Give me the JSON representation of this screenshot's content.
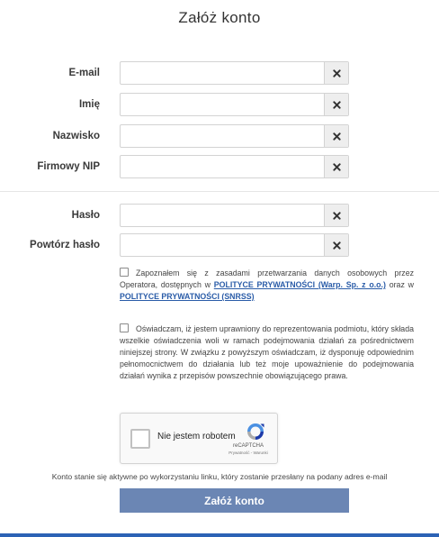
{
  "page_title": "Załóż konto",
  "fields": [
    {
      "label": "E-mail",
      "value": ""
    },
    {
      "label": "Imię",
      "value": ""
    },
    {
      "label": "Nazwisko",
      "value": ""
    },
    {
      "label": "Firmowy NIP",
      "value": ""
    },
    {
      "label": "Hasło",
      "value": ""
    },
    {
      "label": "Powtórz hasło",
      "value": ""
    }
  ],
  "clear_icon": "close-icon",
  "consent1": {
    "checked": false,
    "text_part1": "Zapoznałem się z zasadami przetwarzania danych osobowych przez Operatora, dostępnych w ",
    "link1": "POLITYCE PRYWATNOŚCI (Warp. Sp. z o.o.)",
    "text_part2": " oraz w ",
    "link2": "POLITYCE PRYWATNOŚCI (SNRSS)"
  },
  "consent2": {
    "checked": false,
    "text": "Oświadczam, iż jestem uprawniony do reprezentowania podmiotu, który składa wszelkie oświadczenia woli w ramach podejmowania działań za pośrednictwem niniejszej strony. W związku z powyższym oświadczam, iż dysponuję odpowiednim pełnomocnictwem do działania lub też moje upoważnienie do podejmowania działań wynika z przepisów powszechnie obowiązującego prawa."
  },
  "captcha": {
    "label": "Nie jestem robotem",
    "brand": "reCAPTCHA",
    "links": "Prywatność - Warunki"
  },
  "notice": "Konto stanie się aktywne po wykorzystaniu linku, który zostanie przesłany na podany adres e-mail",
  "submit_label": "Załóż konto",
  "colors": {
    "accent": "#6b86b4",
    "link": "#2a5ca8",
    "bottom_bar": "#2b62b5"
  }
}
